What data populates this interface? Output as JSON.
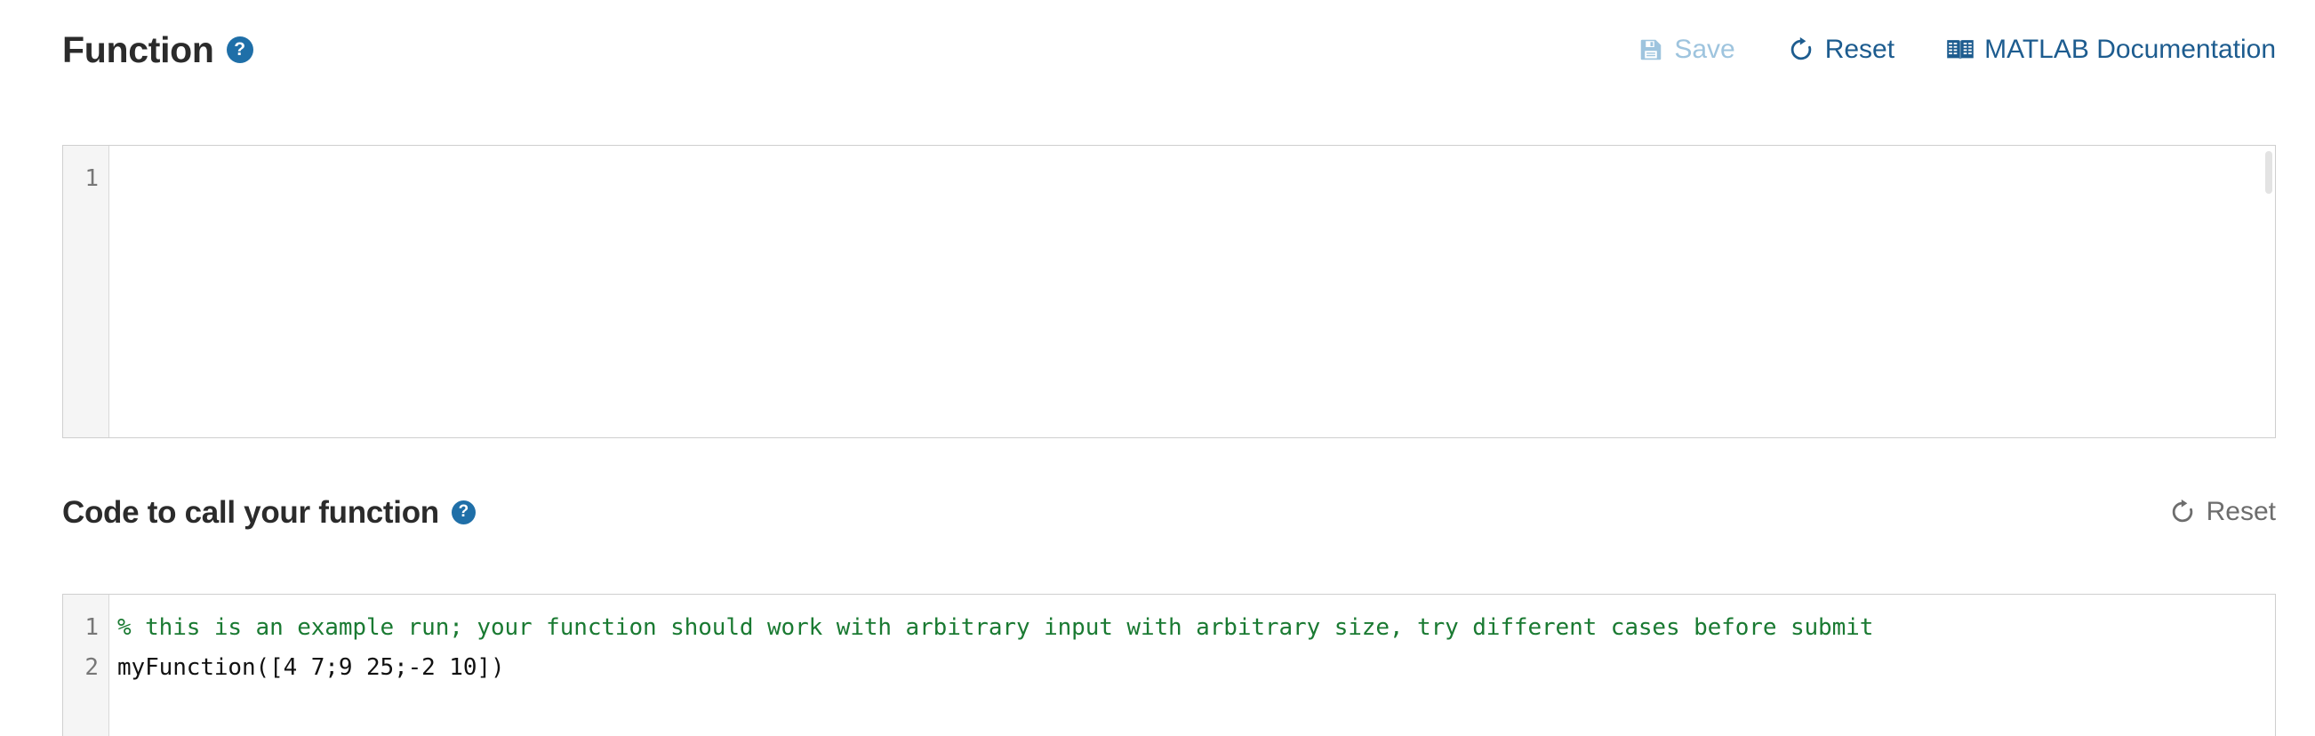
{
  "function_section": {
    "title": "Function",
    "help_icon": "help-circle-icon",
    "help_glyph": "?",
    "toolbar": {
      "save_label": "Save",
      "save_icon": "floppy-disk-save-icon",
      "save_state": "disabled",
      "reset_label": "Reset",
      "reset_icon": "refresh-reset-icon",
      "docs_label": "MATLAB Documentation",
      "docs_icon": "open-book-icon"
    },
    "editor": {
      "line_numbers": [
        "1"
      ],
      "lines": [
        ""
      ]
    }
  },
  "call_section": {
    "title": "Code to call your function",
    "help_icon": "help-circle-icon",
    "help_glyph": "?",
    "toolbar": {
      "reset_label": "Reset",
      "reset_icon": "refresh-reset-icon",
      "reset_state": "muted"
    },
    "editor": {
      "line_numbers": [
        "1",
        "2"
      ],
      "lines": [
        "% this is an example run; your function should work with arbitrary input with arbitrary size, try different cases before submit",
        "myFunction([4 7;9 25;-2 10])"
      ]
    }
  },
  "colors": {
    "accent_blue": "#1d5c8f",
    "help_badge_blue": "#1f6fa8",
    "disabled_blue": "#9ec4de",
    "muted_gray": "#6d6d6d",
    "comment_green": "#1a7a32",
    "code_black": "#111111",
    "editor_border": "#cfcfcf",
    "gutter_bg": "#f5f5f5",
    "title_color": "#2b2b2b"
  }
}
